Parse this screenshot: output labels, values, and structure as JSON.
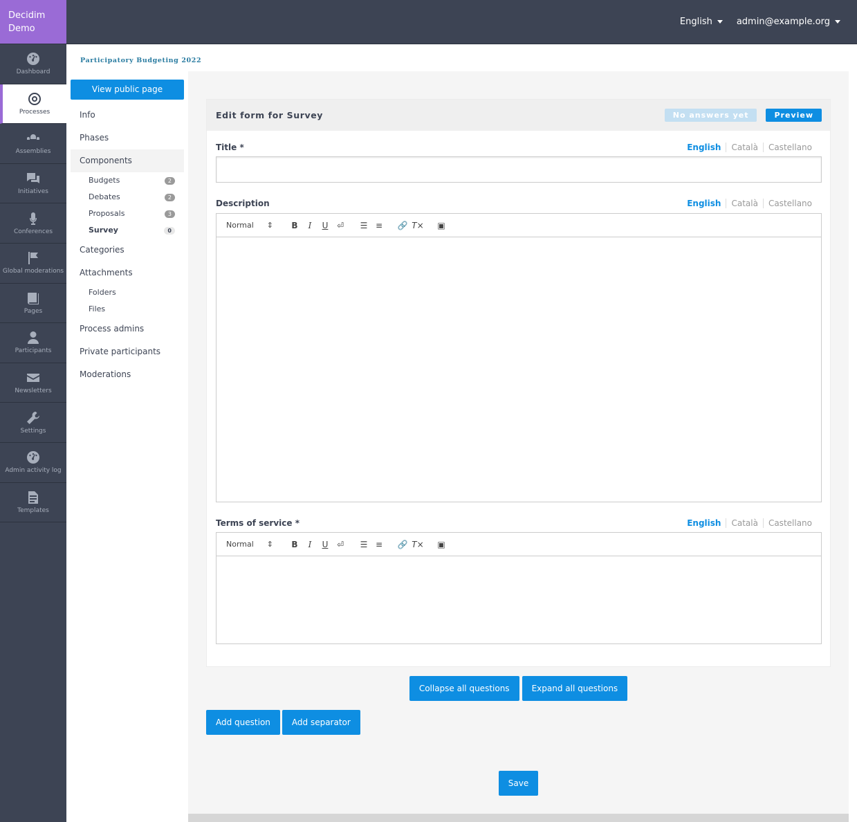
{
  "logo": {
    "line1": "Decidim",
    "line2": "Demo"
  },
  "main_nav": [
    {
      "label": "Dashboard",
      "icon": "dashboard-icon"
    },
    {
      "label": "Processes",
      "icon": "target-icon",
      "active": true
    },
    {
      "label": "Assemblies",
      "icon": "assemblies-icon"
    },
    {
      "label": "Initiatives",
      "icon": "chat-icon"
    },
    {
      "label": "Conferences",
      "icon": "microphone-icon"
    },
    {
      "label": "Global moderations",
      "icon": "flag-icon"
    },
    {
      "label": "Pages",
      "icon": "book-icon"
    },
    {
      "label": "Participants",
      "icon": "person-icon"
    },
    {
      "label": "Newsletters",
      "icon": "envelope-icon"
    },
    {
      "label": "Settings",
      "icon": "wrench-icon"
    },
    {
      "label": "Admin activity log",
      "icon": "dashboard-icon"
    },
    {
      "label": "Templates",
      "icon": "document-icon"
    }
  ],
  "topbar": {
    "language": "English",
    "user": "admin@example.org"
  },
  "breadcrumb": "Participatory Budgeting 2022",
  "sec_nav": {
    "view_public": "View public page",
    "items": {
      "info": "Info",
      "phases": "Phases",
      "components": "Components",
      "categories": "Categories",
      "attachments": "Attachments",
      "process_admins": "Process admins",
      "private_participants": "Private participants",
      "moderations": "Moderations"
    },
    "components": [
      {
        "label": "Budgets",
        "count": "2"
      },
      {
        "label": "Debates",
        "count": "2"
      },
      {
        "label": "Proposals",
        "count": "3"
      },
      {
        "label": "Survey",
        "count": "0"
      }
    ],
    "attachments": [
      {
        "label": "Folders"
      },
      {
        "label": "Files"
      }
    ]
  },
  "form": {
    "title": "Edit form for Survey",
    "no_answers": "No answers yet",
    "preview": "Preview",
    "languages": [
      "English",
      "Català",
      "Castellano"
    ],
    "title_label": "Title",
    "description_label": "Description",
    "tos_label": "Terms of service",
    "required_mark": "*",
    "toolbar_format": "Normal",
    "title_value": ""
  },
  "actions": {
    "collapse": "Collapse all questions",
    "expand": "Expand all questions",
    "add_question": "Add question",
    "add_separator": "Add separator",
    "save": "Save"
  },
  "colors": {
    "primary": "#0e8ee2",
    "brand": "#9a6bd6",
    "nav_bg": "#3d4454",
    "crumb": "#2a7ca1"
  }
}
